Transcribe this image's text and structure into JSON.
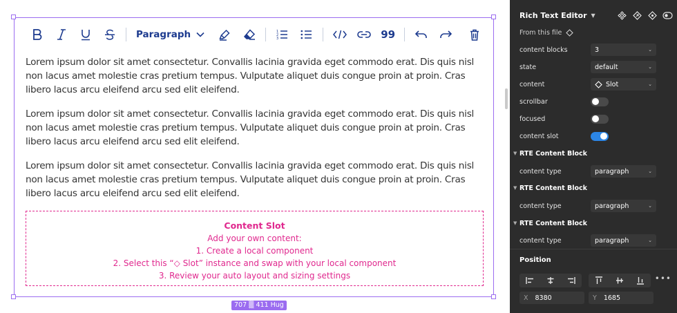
{
  "toolbar": {
    "buttons": [
      "bold-icon",
      "italic-icon",
      "underline-icon",
      "strikethrough-icon"
    ],
    "paragraph_label": "Paragraph",
    "code_label": "</>",
    "quote_label": "99"
  },
  "content": {
    "paragraphs": [
      "Lorem ipsum dolor sit amet consectetur. Convallis lacinia gravida eget commodo erat. Dis quis nisl non lacus amet molestie cras pretium tempus. Vulputate aliquet duis congue proin at proin. Cras libero lacus arcu eleifend arcu sed elit eleifend.",
      "Lorem ipsum dolor sit amet consectetur. Convallis lacinia gravida eget commodo erat. Dis quis nisl non lacus amet molestie cras pretium tempus. Vulputate aliquet duis congue proin at proin. Cras libero lacus arcu eleifend arcu sed elit eleifend.",
      "Lorem ipsum dolor sit amet consectetur. Convallis lacinia gravida eget commodo erat. Dis quis nisl non lacus amet molestie cras pretium tempus. Vulputate aliquet duis congue proin at proin. Cras libero lacus arcu eleifend arcu sed elit eleifend."
    ],
    "slot": {
      "title": "Content Slot",
      "line1": "Add your own content:",
      "line2": "1. Create a local component",
      "line3": "2. Select this “◇ Slot” instance and swap with your local component",
      "line4": "3. Review your auto layout and sizing settings"
    }
  },
  "size_badge": "707 ▒ 411 Hug",
  "panel": {
    "title": "Rich Text Editor",
    "from_file": "From this file",
    "props": {
      "content_blocks_label": "content blocks",
      "content_blocks_value": "3",
      "state_label": "state",
      "state_value": "default",
      "content_label": "content",
      "content_value": "Slot",
      "scrollbar_label": "scrollbar",
      "scrollbar_on": false,
      "focused_label": "focused",
      "focused_on": false,
      "content_slot_label": "content slot",
      "content_slot_on": true
    },
    "blocks": [
      {
        "title": "RTE Content Block",
        "type_label": "content type",
        "type_value": "paragraph"
      },
      {
        "title": "RTE Content Block",
        "type_label": "content type",
        "type_value": "paragraph"
      },
      {
        "title": "RTE Content Block",
        "type_label": "content type",
        "type_value": "paragraph"
      }
    ],
    "position": {
      "title": "Position",
      "x_label": "X",
      "x_value": "8380",
      "y_label": "Y",
      "y_value": "1685"
    }
  },
  "colors": {
    "frame": "#9b6cf0",
    "slot": "#e0288e",
    "toolbar_icons": "#1d3b8f",
    "toggle_on": "#2c86e6",
    "panel_bg": "#2c2c2c"
  }
}
